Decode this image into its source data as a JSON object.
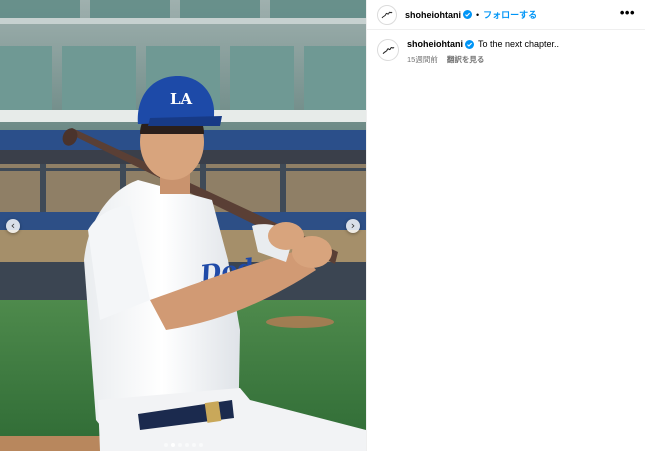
{
  "post": {
    "username": "shoheiohtani",
    "follow_label": "フォローする",
    "separator": "•",
    "more_label": "•••"
  },
  "caption": {
    "username": "shoheiohtani",
    "text": "To the next chapter..",
    "timestamp": "15週間前",
    "translate_label": "翻訳を見る"
  },
  "media": {
    "cap_logo": "LA",
    "jersey_text": "Dodgers",
    "prev_glyph": "‹",
    "next_glyph": "›",
    "carousel_count": 6,
    "carousel_active_index": 1
  },
  "colors": {
    "accent_blue": "#0095f6",
    "verified_blue": "#0095f6",
    "dodger_blue": "#1f4aa8"
  },
  "icons": {
    "avatar": "signature-avatar-icon",
    "verified": "verified-badge-icon",
    "prev": "chevron-left-icon",
    "next": "chevron-right-icon",
    "more": "more-options-icon"
  }
}
